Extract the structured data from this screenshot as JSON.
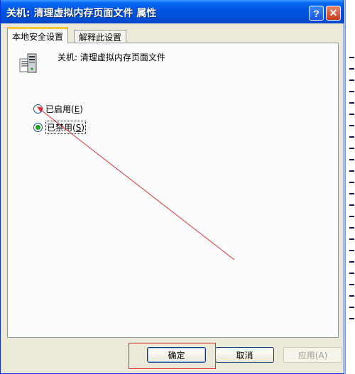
{
  "window": {
    "title": "关机: 清理虚拟内存页面文件 属性",
    "help_glyph": "?",
    "close_glyph": "✕"
  },
  "tabs": [
    {
      "label": "本地安全设置"
    },
    {
      "label": "解释此设置"
    }
  ],
  "policy": {
    "icon": "policy-computer-icon",
    "title": "关机: 清理虚拟内存页面文件"
  },
  "options": [
    {
      "label": "已启用(",
      "key": "E",
      "close": ")",
      "selected": false
    },
    {
      "label": "已禁用(",
      "key": "S",
      "close": ")",
      "selected": true
    }
  ],
  "buttons": {
    "ok": "确定",
    "cancel": "取消",
    "apply": "应用(A)"
  },
  "colors": {
    "titlebar": "#0054e3",
    "dialog_bg": "#ece9d8",
    "annotation": "#e03030"
  }
}
